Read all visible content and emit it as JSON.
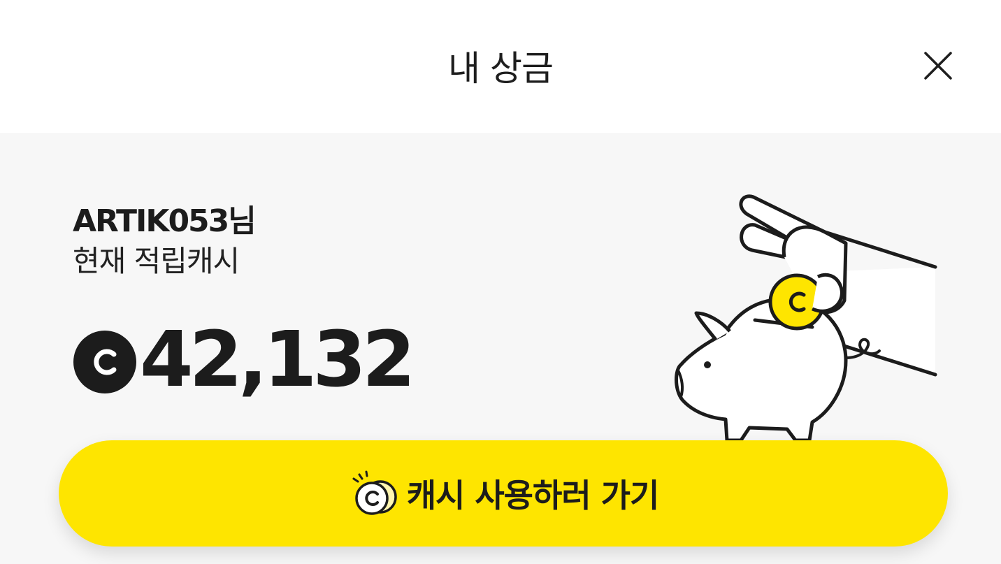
{
  "header": {
    "title": "내 상금",
    "close_icon": "close-icon"
  },
  "account": {
    "user_name": "ARTIK053님",
    "cash_label": "현재 적립캐시",
    "cash_amount": "42,132",
    "currency_icon": "cash-coin-icon"
  },
  "illustration": {
    "icon": "piggy-bank-icon",
    "coin_color": "#FEE500"
  },
  "cta": {
    "label": "캐시 사용하러 가기",
    "icon": "coins-icon",
    "color": "#FEE500"
  }
}
